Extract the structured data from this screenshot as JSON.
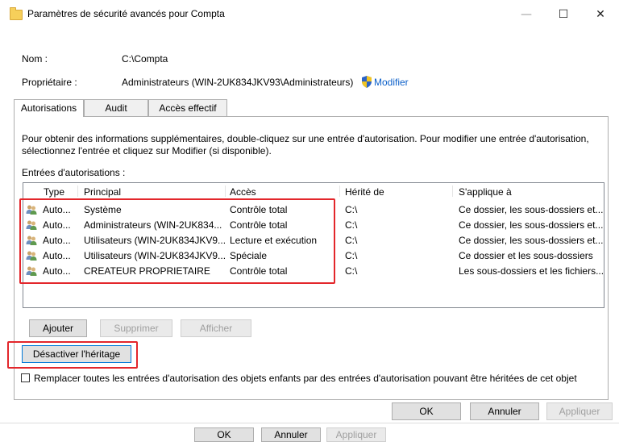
{
  "window": {
    "title": "Paramètres de sécurité avancés pour Compta",
    "minimize": "—",
    "maximize": "☐",
    "close": "✕"
  },
  "info": {
    "name_label": "Nom :",
    "name_value": "C:\\Compta",
    "owner_label": "Propriétaire :",
    "owner_value": "Administrateurs (WIN-2UK834JKV93\\Administrateurs)",
    "owner_change": "Modifier"
  },
  "tabs": [
    {
      "label": "Autorisations",
      "active": true
    },
    {
      "label": "Audit",
      "active": false
    },
    {
      "label": "Accès effectif",
      "active": false
    }
  ],
  "help_text_1": "Pour obtenir des informations supplémentaires, double-cliquez sur une entrée d'autorisation. Pour modifier une entrée d'autorisation,",
  "help_text_2": "sélectionnez l'entrée et cliquez sur Modifier (si disponible).",
  "entries_label": "Entrées d'autorisations :",
  "columns": [
    "Type",
    "Principal",
    "Accès",
    "Hérité de",
    "S'applique à"
  ],
  "rows": [
    {
      "type": "Auto...",
      "principal": "Système",
      "access": "Contrôle total",
      "inherited": "C:\\",
      "applies": "Ce dossier, les sous-dossiers et..."
    },
    {
      "type": "Auto...",
      "principal": "Administrateurs (WIN-2UK834...",
      "access": "Contrôle total",
      "inherited": "C:\\",
      "applies": "Ce dossier, les sous-dossiers et..."
    },
    {
      "type": "Auto...",
      "principal": "Utilisateurs (WIN-2UK834JKV9...",
      "access": "Lecture et exécution",
      "inherited": "C:\\",
      "applies": "Ce dossier, les sous-dossiers et..."
    },
    {
      "type": "Auto...",
      "principal": "Utilisateurs (WIN-2UK834JKV9...",
      "access": "Spéciale",
      "inherited": "C:\\",
      "applies": "Ce dossier et les sous-dossiers"
    },
    {
      "type": "Auto...",
      "principal": "CREATEUR PROPRIETAIRE",
      "access": "Contrôle total",
      "inherited": "C:\\",
      "applies": "Les sous-dossiers et les fichiers..."
    }
  ],
  "buttons": {
    "add": "Ajouter",
    "remove": "Supprimer",
    "view": "Afficher",
    "disable_inheritance": "Désactiver l'héritage",
    "ok": "OK",
    "cancel": "Annuler",
    "apply": "Appliquer"
  },
  "replace_checkbox": {
    "label": "Remplacer toutes les entrées d'autorisation des objets enfants par des entrées d'autorisation pouvant être héritées de cet objet",
    "checked": false
  },
  "colors": {
    "highlight": "#e3262b",
    "link": "#0b5fc9",
    "focus": "#0078d7"
  }
}
